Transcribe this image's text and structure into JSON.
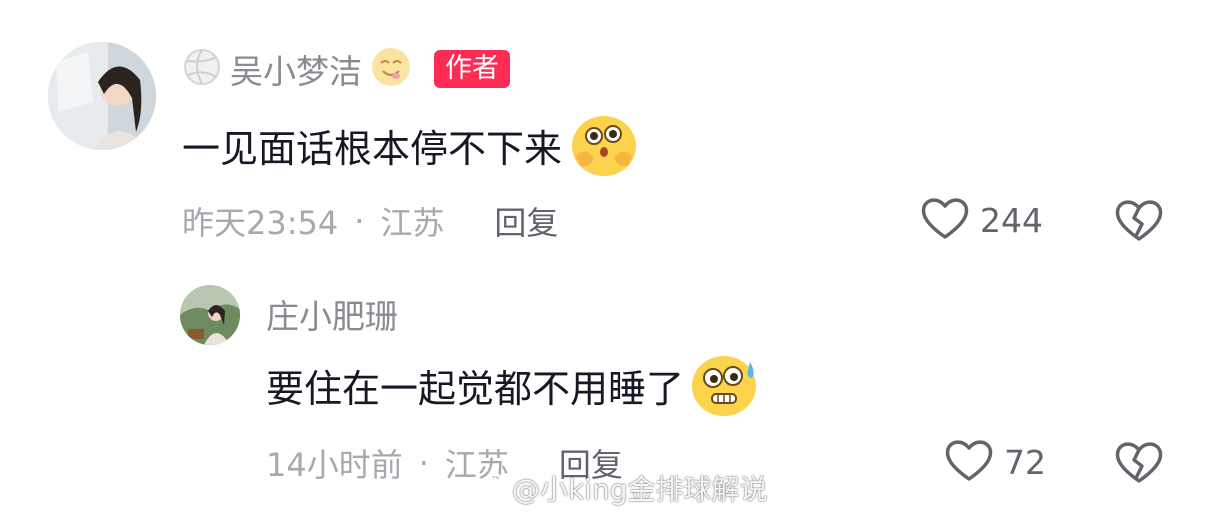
{
  "comments": [
    {
      "username": "吴小梦洁",
      "username_prefix_icon": "volleyball-icon",
      "username_suffix_icon": "yum-emoji-icon",
      "badge": "作者",
      "text": "一见面话根本停不下来",
      "emoji": "shy-kiss-emoji-icon",
      "time": "昨天23:54",
      "separator": "·",
      "location": "江苏",
      "reply_label": "回复",
      "like_count": "244",
      "like_icon": "heart-outline-icon",
      "dislike_icon": "broken-heart-icon"
    },
    {
      "username": "庄小肥珊",
      "text": "要住在一起觉都不用睡了",
      "emoji": "nervous-sweat-emoji-icon",
      "time": "14小时前",
      "separator": "·",
      "location": "江苏",
      "reply_label": "回复",
      "like_count": "72",
      "like_icon": "heart-outline-icon",
      "dislike_icon": "broken-heart-icon"
    }
  ],
  "watermark": {
    "text": "@小king金排球解说",
    "icon": "weibo-logo-icon"
  },
  "colors": {
    "badge": "#fe2c55",
    "username": "#8a8b91",
    "meta": "#a8a9ae",
    "icon": "#62646b"
  }
}
